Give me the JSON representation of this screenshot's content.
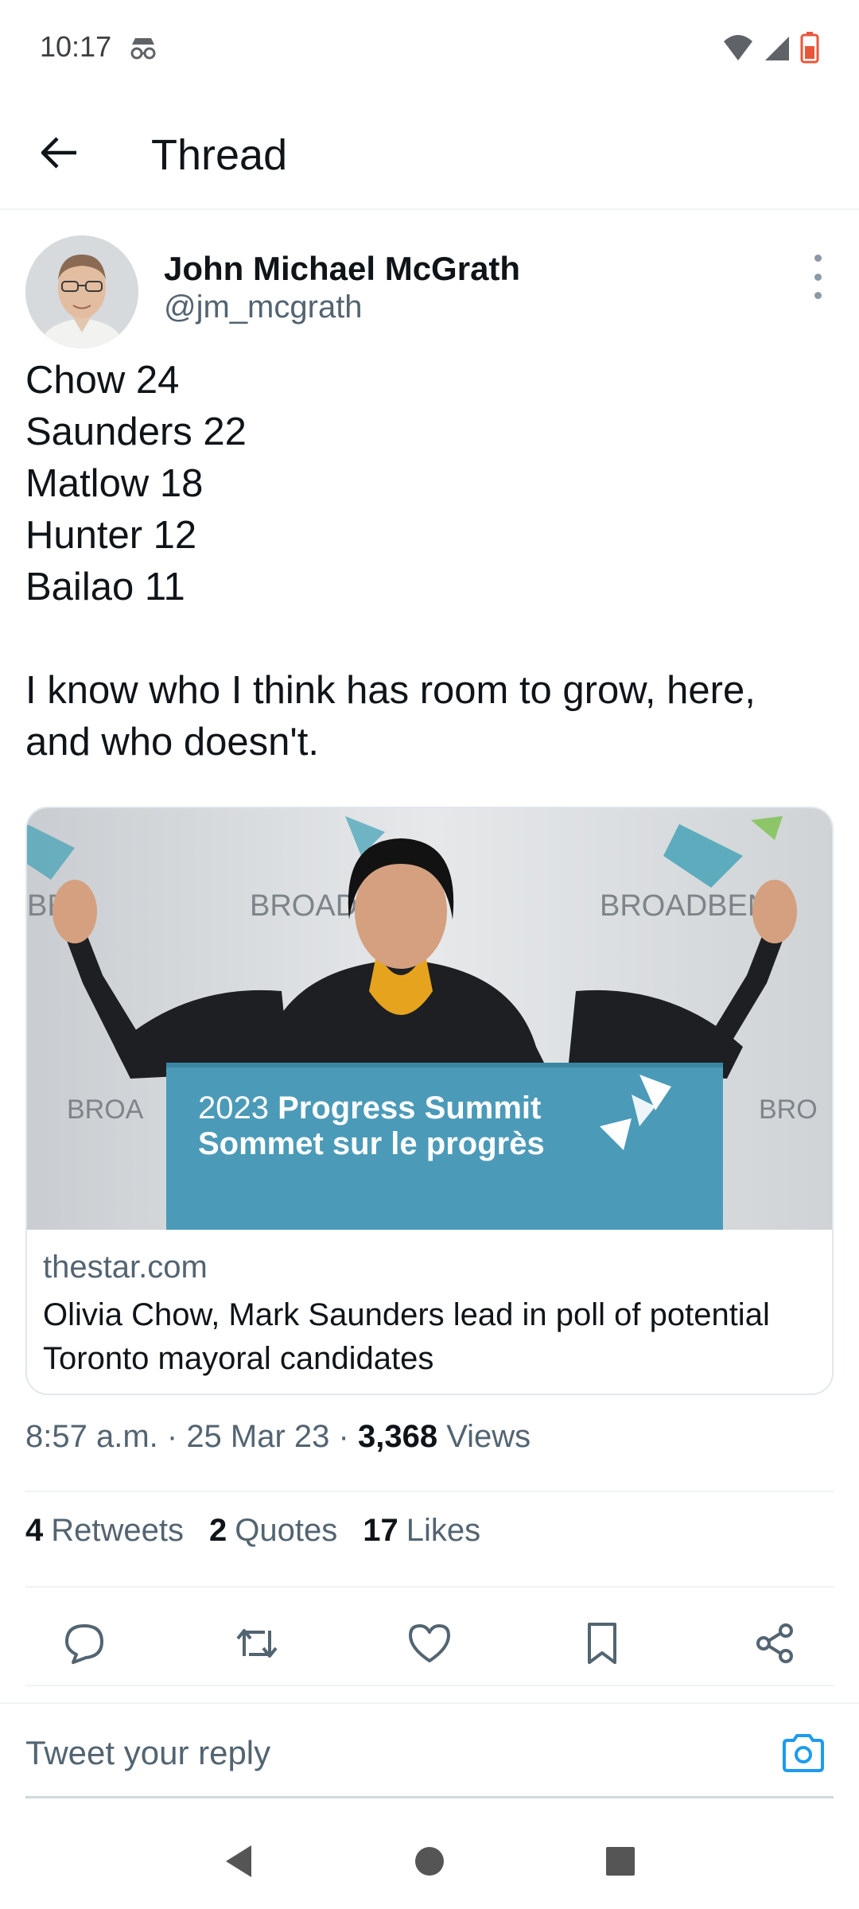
{
  "status_bar": {
    "time": "10:17"
  },
  "header": {
    "title": "Thread"
  },
  "tweet": {
    "author": {
      "name": "John Michael McGrath",
      "handle": "@jm_mcgrath"
    },
    "text_lines": [
      "Chow 24",
      "Saunders 22",
      "Matlow 18",
      "Hunter 12",
      "Bailao 11"
    ],
    "text_paragraph": [
      "I know who I think has room to grow, here,",
      "and who doesn't."
    ],
    "card": {
      "image_banner_line1_year": "2023",
      "image_banner_line1": "Progress Summit",
      "image_banner_line2": "Sommet sur le progrès",
      "domain": "thestar.com",
      "title": "Olivia Chow, Mark Saunders lead in poll of potential Toronto mayoral candidates"
    },
    "meta": {
      "time": "8:57 a.m.",
      "date": "25 Mar 23",
      "views_count": "3,368",
      "views_label": "Views"
    },
    "stats": [
      {
        "count": "4",
        "label": "Retweets"
      },
      {
        "count": "2",
        "label": "Quotes"
      },
      {
        "count": "17",
        "label": "Likes"
      }
    ]
  },
  "reply": {
    "placeholder": "Tweet your reply"
  },
  "colors": {
    "accent": "#1d9bf0",
    "text": "#0f1419",
    "secondary": "#536471"
  },
  "icons": [
    "back-arrow-icon",
    "more-vertical-icon",
    "reply-icon",
    "retweet-icon",
    "like-icon",
    "bookmark-icon",
    "share-icon",
    "camera-icon"
  ]
}
